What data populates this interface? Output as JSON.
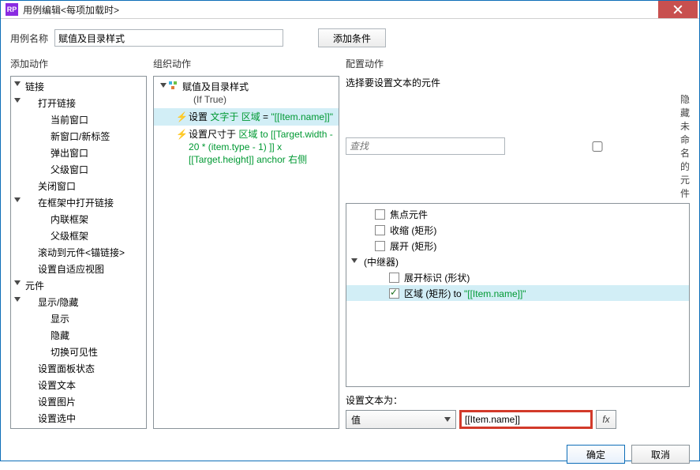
{
  "window": {
    "title": "用例编辑<每项加载时>"
  },
  "row1": {
    "nameLabel": "用例名称",
    "nameValue": "赋值及目录样式",
    "addCondition": "添加条件"
  },
  "columns": {
    "addAction": "添加动作",
    "orgAction": "组织动作",
    "cfgAction": "配置动作"
  },
  "addTree": {
    "g1": {
      "label": "链接",
      "g11": {
        "label": "打开链接",
        "i1": "当前窗口",
        "i2": "新窗口/新标签",
        "i3": "弹出窗口",
        "i4": "父级窗口"
      },
      "i_close": "关闭窗口",
      "g12": {
        "label": "在框架中打开链接",
        "i1": "内联框架",
        "i2": "父级框架"
      },
      "i_scroll": "滚动到元件<锚链接>",
      "i_adapt": "设置自适应视图"
    },
    "g2": {
      "label": "元件",
      "g21": {
        "label": "显示/隐藏",
        "i1": "显示",
        "i2": "隐藏",
        "i3": "切换可见性"
      },
      "i_panel": "设置面板状态",
      "i_text": "设置文本",
      "i_image": "设置图片",
      "i_selected": "设置选中"
    }
  },
  "org": {
    "row0": {
      "main": "赋值及目录样式",
      "sub": "(If True)"
    },
    "row1": {
      "prefix": "设置 ",
      "green": "文字于 区域",
      "mid": " = ",
      "val": "\"[[Item.name]]\""
    },
    "row2": {
      "prefix": "设置尺寸于 ",
      "green": "区域 to [[Target.width - 20 * (item.type - 1) ]] x [[Target.height]] anchor 右侧"
    }
  },
  "cfg": {
    "chooseLabel": "选择要设置文本的元件",
    "searchPlaceholder": "查找",
    "hideUnnamed": "隐藏未命名的元件",
    "items": {
      "focus": "焦点元件",
      "collapse": "收缩 (矩形)",
      "expand": "展开 (矩形)",
      "repeater": "(中继器)",
      "expandFlag": "展开标识 (形状)",
      "area": {
        "label": "区域 (矩形) to ",
        "val": "\"[[Item.name]]\""
      }
    },
    "setTextLabel": "设置文本为：",
    "ddValue": "值",
    "textValue": "[[Item.name]]",
    "fx": "fx"
  },
  "footer": {
    "ok": "确定",
    "cancel": "取消"
  }
}
